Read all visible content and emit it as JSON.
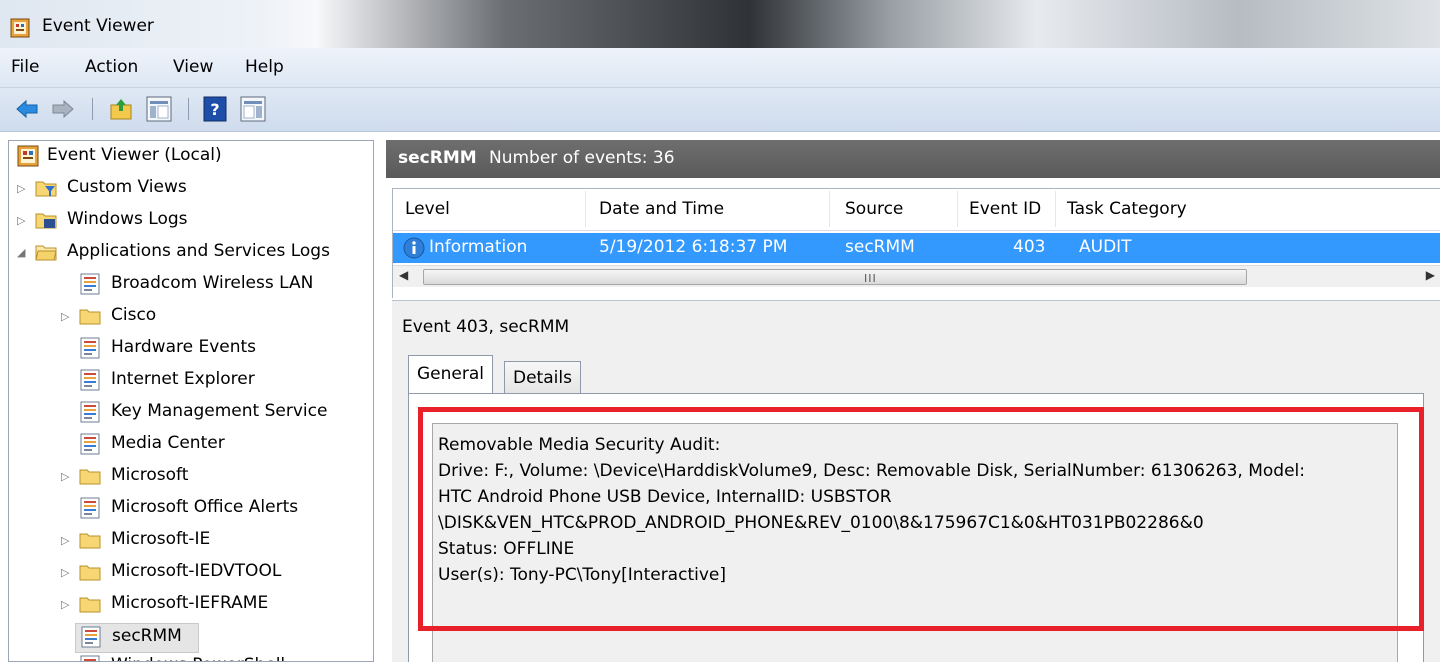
{
  "window": {
    "title": "Event Viewer"
  },
  "menu": {
    "items": [
      "File",
      "Action",
      "View",
      "Help"
    ]
  },
  "toolbar": {
    "icons": [
      "back-arrow-icon",
      "forward-arrow-icon",
      "up-folder-icon",
      "show-hide-console-tree-icon",
      "help-icon",
      "show-hide-action-pane-icon"
    ]
  },
  "tree": {
    "items": [
      {
        "label": "Event Viewer (Local)",
        "icon": "event-viewer-icon",
        "expander": ""
      },
      {
        "label": "Custom Views",
        "icon": "folder-filter-icon",
        "expander": "▷"
      },
      {
        "label": "Windows Logs",
        "icon": "folder-log-icon",
        "expander": "▷"
      },
      {
        "label": "Applications and Services Logs",
        "icon": "folder-open-icon",
        "expander": "◢"
      },
      {
        "label": "Broadcom Wireless LAN",
        "icon": "log-icon",
        "expander": ""
      },
      {
        "label": "Cisco",
        "icon": "folder-icon",
        "expander": "▷"
      },
      {
        "label": "Hardware Events",
        "icon": "log-icon",
        "expander": ""
      },
      {
        "label": "Internet Explorer",
        "icon": "log-icon",
        "expander": ""
      },
      {
        "label": "Key Management Service",
        "icon": "log-icon",
        "expander": ""
      },
      {
        "label": "Media Center",
        "icon": "log-icon",
        "expander": ""
      },
      {
        "label": "Microsoft",
        "icon": "folder-icon",
        "expander": "▷"
      },
      {
        "label": "Microsoft Office Alerts",
        "icon": "log-icon",
        "expander": ""
      },
      {
        "label": "Microsoft-IE",
        "icon": "folder-icon",
        "expander": "▷"
      },
      {
        "label": "Microsoft-IEDVTOOL",
        "icon": "folder-icon",
        "expander": "▷"
      },
      {
        "label": "Microsoft-IEFRAME",
        "icon": "folder-icon",
        "expander": "▷"
      },
      {
        "label": "secRMM",
        "icon": "log-icon",
        "expander": ""
      },
      {
        "label": "Windows PowerShell",
        "icon": "log-icon",
        "expander": ""
      }
    ]
  },
  "header": {
    "log_name": "secRMM",
    "count_text": "Number of events: 36"
  },
  "grid": {
    "columns": [
      "Level",
      "Date and Time",
      "Source",
      "Event ID",
      "Task Category"
    ],
    "rows": [
      {
        "level": "Information",
        "datetime": "5/19/2012 6:18:37 PM",
        "source": "secRMM",
        "event_id": "403",
        "task_category": "AUDIT"
      }
    ]
  },
  "detail": {
    "title": "Event 403, secRMM",
    "tabs": [
      "General",
      "Details"
    ],
    "lines": [
      "Removable Media Security Audit:",
      "Drive: F:, Volume: \\Device\\HarddiskVolume9, Desc: Removable Disk, SerialNumber: 61306263, Model:",
      "HTC Android Phone USB Device, InternalID: USBSTOR",
      "\\DISK&VEN_HTC&PROD_ANDROID_PHONE&REV_0100\\8&175967C1&0&HT031PB02286&0",
      "Status: OFFLINE",
      "User(s): Tony-PC\\Tony[Interactive]"
    ]
  },
  "colors": {
    "selection": "#3399ff",
    "highlight_box": "#e8202a",
    "header_strip": "#606060"
  }
}
